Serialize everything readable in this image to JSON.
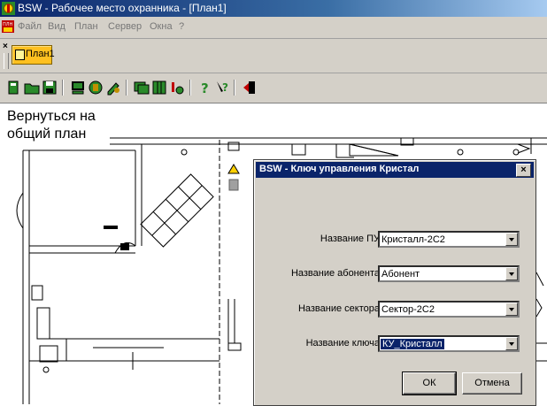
{
  "window": {
    "title": "BSW - Рабочее место охранника - [План1]"
  },
  "menu": {
    "items": [
      "Файл",
      "Вид",
      "План",
      "Сервер",
      "Окна",
      "?"
    ]
  },
  "doc_tabs": {
    "close_glyph": "×",
    "active": "План1"
  },
  "toolbar": {
    "buttons": [
      "open-icon",
      "folder-icon",
      "save-icon",
      "monitor-icon",
      "server-icon",
      "edit-icon",
      "window-icon",
      "columns-icon",
      "alarm-icon",
      "help-icon",
      "context-help-icon",
      "exit-icon"
    ]
  },
  "plan": {
    "back_link": "Вернуться на\nобщий план"
  },
  "dialog": {
    "title": "BSW - Ключ управления Кристал",
    "close_glyph": "×",
    "fields": [
      {
        "label": "Название ПУ",
        "value": "Кристалл-2С2"
      },
      {
        "label": "Название абонента",
        "value": "Абонент"
      },
      {
        "label": "Название сектора",
        "value": "Сектор-2С2"
      },
      {
        "label": "Название ключа",
        "value": "КУ_Кристалл"
      }
    ],
    "ok_label": "ОК",
    "cancel_label": "Отмена"
  },
  "colors": {
    "titlebar": "#0a246a",
    "face": "#d4d0c8",
    "tab_active": "#ffc020",
    "highlight": "#0a246a"
  }
}
